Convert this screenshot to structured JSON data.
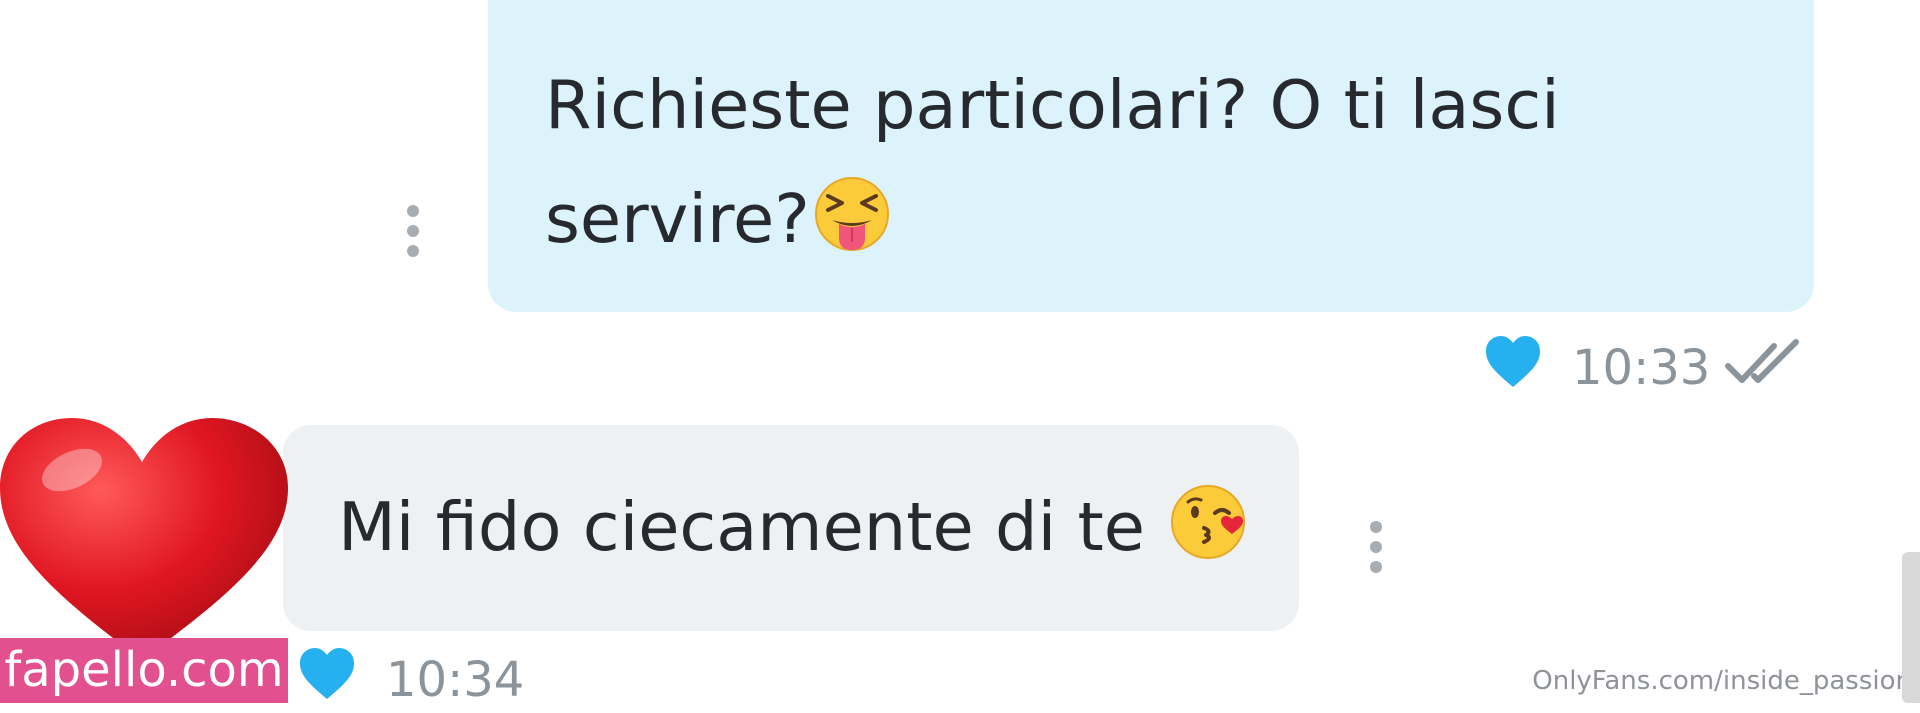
{
  "messages": [
    {
      "direction": "outgoing",
      "text_line1": "Richieste particolari? O ti lasci",
      "text_line2": "servire?",
      "emoji": "squinting-face-with-tongue-icon",
      "time": "10:33",
      "status": "read-double-check-icon",
      "liked": true
    },
    {
      "direction": "incoming",
      "text": "Mi fido ciecamente di te",
      "emoji": "face-blowing-a-kiss-icon",
      "time": "10:34",
      "liked": true
    }
  ],
  "overlay": {
    "brand_badge": "fapello.com",
    "watermark": "OnlyFans.com/inside_passion",
    "decor_icon": "red-heart-icon"
  },
  "colors": {
    "bubble_outgoing": "#ddf3fc",
    "bubble_incoming": "#eef1f3",
    "like_heart": "#27b0ef",
    "brand_badge": "#e2508f",
    "text": "#262a2e",
    "meta_text": "#8b939b"
  }
}
